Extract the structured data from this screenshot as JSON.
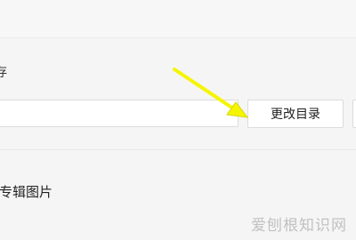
{
  "settings": {
    "section_label": "存",
    "path_value": "",
    "change_dir_button_label": "更改目录",
    "option_label": "专辑图片"
  },
  "annotation": {
    "arrow_color": "#f5f500"
  },
  "watermark": {
    "text": "爱刨根知识网"
  }
}
